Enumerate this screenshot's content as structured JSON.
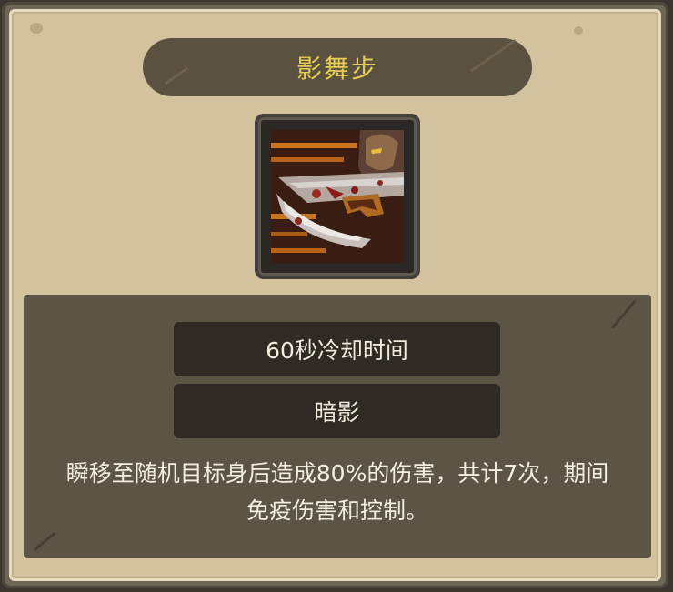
{
  "skill": {
    "name": "影舞步",
    "cooldown": "60秒冷却时间",
    "type": "暗影",
    "description": "瞬移至随机目标身后造成80%的伤害，共计7次，期间免疫伤害和控制。",
    "icon": "shadow-dagger-assassin-icon"
  },
  "colors": {
    "parchment": "#d2c29e",
    "banner": "#5b5140",
    "title": "#e6cd55",
    "panel": "#5c5444",
    "bar": "#2f2a23",
    "text": "#f4eee2"
  }
}
